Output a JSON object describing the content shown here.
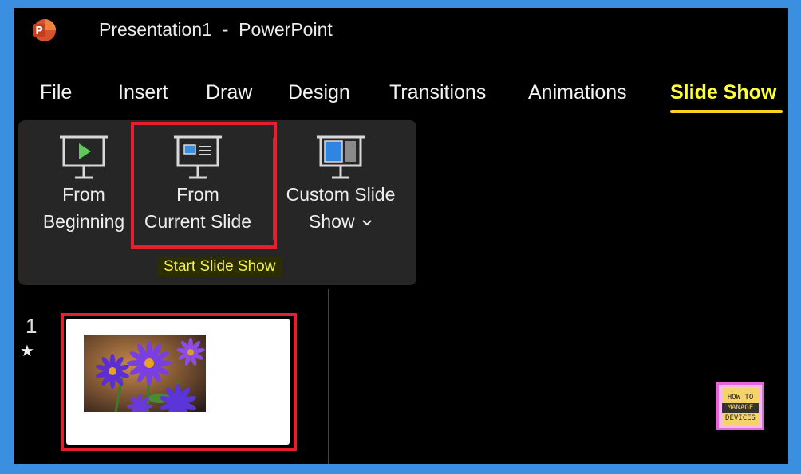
{
  "window": {
    "app_title": "Presentation1  -  PowerPoint"
  },
  "ribbon_tabs": [
    {
      "label": "File"
    },
    {
      "label": "Insert"
    },
    {
      "label": "Draw"
    },
    {
      "label": "Design"
    },
    {
      "label": "Transitions"
    },
    {
      "label": "Animations"
    },
    {
      "label": "Slide Show",
      "active": true
    }
  ],
  "ribbon": {
    "from_beginning": {
      "line1": "From",
      "line2": "Beginning"
    },
    "from_current": {
      "line1": "From",
      "line2": "Current Slide"
    },
    "custom_show": {
      "line1": "Custom Slide",
      "line2": "Show"
    },
    "group_label": "Start Slide Show"
  },
  "slides": [
    {
      "number": "1",
      "transition_marker": "★"
    }
  ],
  "watermark": {
    "line1": "HOW TO",
    "line2": "MANAGE",
    "line3": "DEVICES"
  },
  "colors": {
    "active_tab": "#ffff3a",
    "tab_underline": "#ffd21f",
    "highlight_box": "#e3202d",
    "outer_border": "#3a8fe0"
  }
}
